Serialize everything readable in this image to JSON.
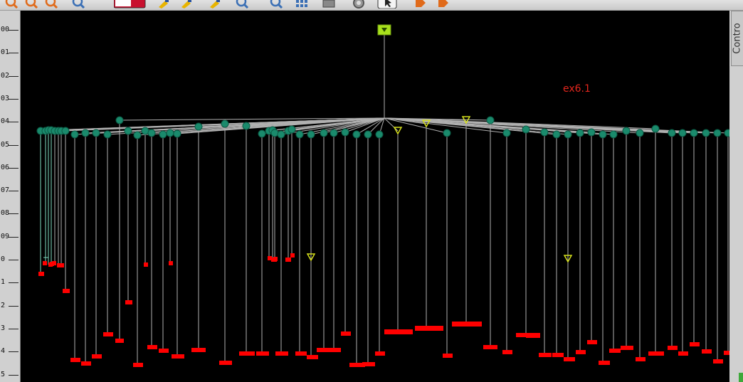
{
  "toolbar": {
    "tools": [
      {
        "name": "zoom-in-icon",
        "color": "#e06a1a"
      },
      {
        "name": "zoom-out-icon",
        "color": "#e06a1a"
      },
      {
        "name": "zoom-region-icon",
        "color": "#e06a1a"
      },
      {
        "name": "zoom-fit-icon",
        "color": "#3a6fb5"
      },
      {
        "name": "color-scheme-icon",
        "color": "#c8102e"
      },
      {
        "name": "paint-brush-icon",
        "color": "#e8b400"
      },
      {
        "name": "paint-brush-alt-icon",
        "color": "#e8b400"
      },
      {
        "name": "paint-brush-multi-icon",
        "color": "#e8b400"
      },
      {
        "name": "magnify-icon",
        "color": "#3a6fb5"
      },
      {
        "name": "search-icon",
        "color": "#3a6fb5"
      },
      {
        "name": "grid-layout-icon",
        "color": "#3a6fb5"
      },
      {
        "name": "print-icon",
        "color": "#666666"
      },
      {
        "name": "gear-icon",
        "color": "#666666"
      },
      {
        "name": "pointer-icon",
        "color": "#222222",
        "selected": true
      },
      {
        "name": "tag-icon",
        "color": "#e06a1a"
      },
      {
        "name": "tag-remove-icon",
        "color": "#e06a1a"
      }
    ]
  },
  "ruler": {
    "labels": [
      "00",
      "01",
      "02",
      "03",
      "04",
      "05",
      "06",
      "07",
      "08",
      "09",
      "0",
      "1",
      "2",
      "3",
      "4",
      "5"
    ]
  },
  "control_tab": {
    "label": "Contro"
  },
  "tree": {
    "label": "ex6.1",
    "colors": {
      "background": "#000000",
      "branch": "#b0b0b0",
      "internal_node": "#1a8a6c",
      "collapsed_node": "#d6e01c",
      "root_node": "#a8e01c",
      "leaf_label": "#ff0000",
      "tree_label": "#e3261d"
    }
  }
}
